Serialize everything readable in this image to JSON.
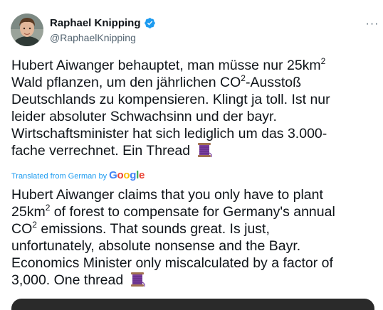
{
  "author": {
    "name": "Raphael Knipping",
    "handle": "@RaphaelKnipping",
    "verified": true
  },
  "icons": {
    "more": "more-icon",
    "verified": "verified-badge-icon",
    "thread": "spool-of-thread-emoji"
  },
  "more_label": "···",
  "original_text": {
    "l1a": "Hubert Aiwanger behauptet, man müsse nur 25km",
    "l1sup": "2",
    "l2a": "Wald pflanzen, um den jährlichen CO",
    "l2sup": "2",
    "l2b": "-Ausstoß",
    "l3": "Deutschlands zu kompensieren. Klingt ja toll. Ist nur",
    "l4": "leider absoluter Schwachsinn und der bayr.",
    "l5": "Wirtschaftsminister hat sich lediglich um das 3.000-",
    "l6": "fache verrechnet. Ein Thread"
  },
  "translation": {
    "label": "Translated from German by",
    "provider_letters": [
      "G",
      "o",
      "o",
      "g",
      "l",
      "e"
    ]
  },
  "translated_text": {
    "l1": "Hubert Aiwanger claims that you only have to plant",
    "l2a": "25km",
    "l2sup": "2",
    "l2b": " of forest to compensate for Germany's annual",
    "l3a": "CO",
    "l3sup": "2",
    "l3b": " emissions. That sounds great. Is just,",
    "l4": "unfortunately, absolute nonsense and the Bayr.",
    "l5": "Economics Minister only miscalculated by a factor of",
    "l6": "3,000. One thread"
  },
  "colors": {
    "text": "#0f1419",
    "secondary": "#536471",
    "link": "#1d9bf0",
    "verified": "#1d9bf0"
  }
}
